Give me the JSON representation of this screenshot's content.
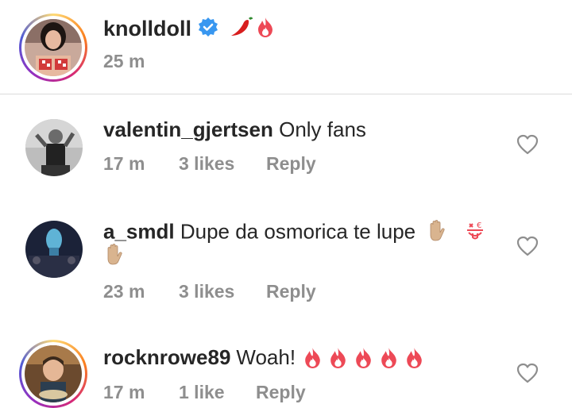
{
  "caption": {
    "username": "knolldoll",
    "time": "25 m",
    "emoji_icons": [
      "verified-badge-icon",
      "hot-pepper-icon",
      "fire-icon"
    ]
  },
  "comments": [
    {
      "username": "valentin_gjertsen",
      "text": "Only fans",
      "time": "17 m",
      "likes": "3 likes",
      "reply": "Reply"
    },
    {
      "username": "a_smdl",
      "text": "Dupe da osmorica te lupe",
      "time": "23 m",
      "likes": "3 likes",
      "reply": "Reply",
      "emoji_icons": [
        "raised-hand-icon",
        "money-mouth-face-icon",
        "raised-hand-icon"
      ]
    },
    {
      "username": "rocknrowe89",
      "text": "Woah!",
      "time": "17 m",
      "likes": "1 like",
      "reply": "Reply",
      "emoji_icons": [
        "fire-icon",
        "fire-icon",
        "fire-icon",
        "fire-icon",
        "fire-icon"
      ]
    }
  ],
  "colors": {
    "text": "#262626",
    "secondary": "#8e8e8e",
    "verified": "#3897f0",
    "fire": "#ed4956",
    "divider": "#dbdbdb"
  }
}
